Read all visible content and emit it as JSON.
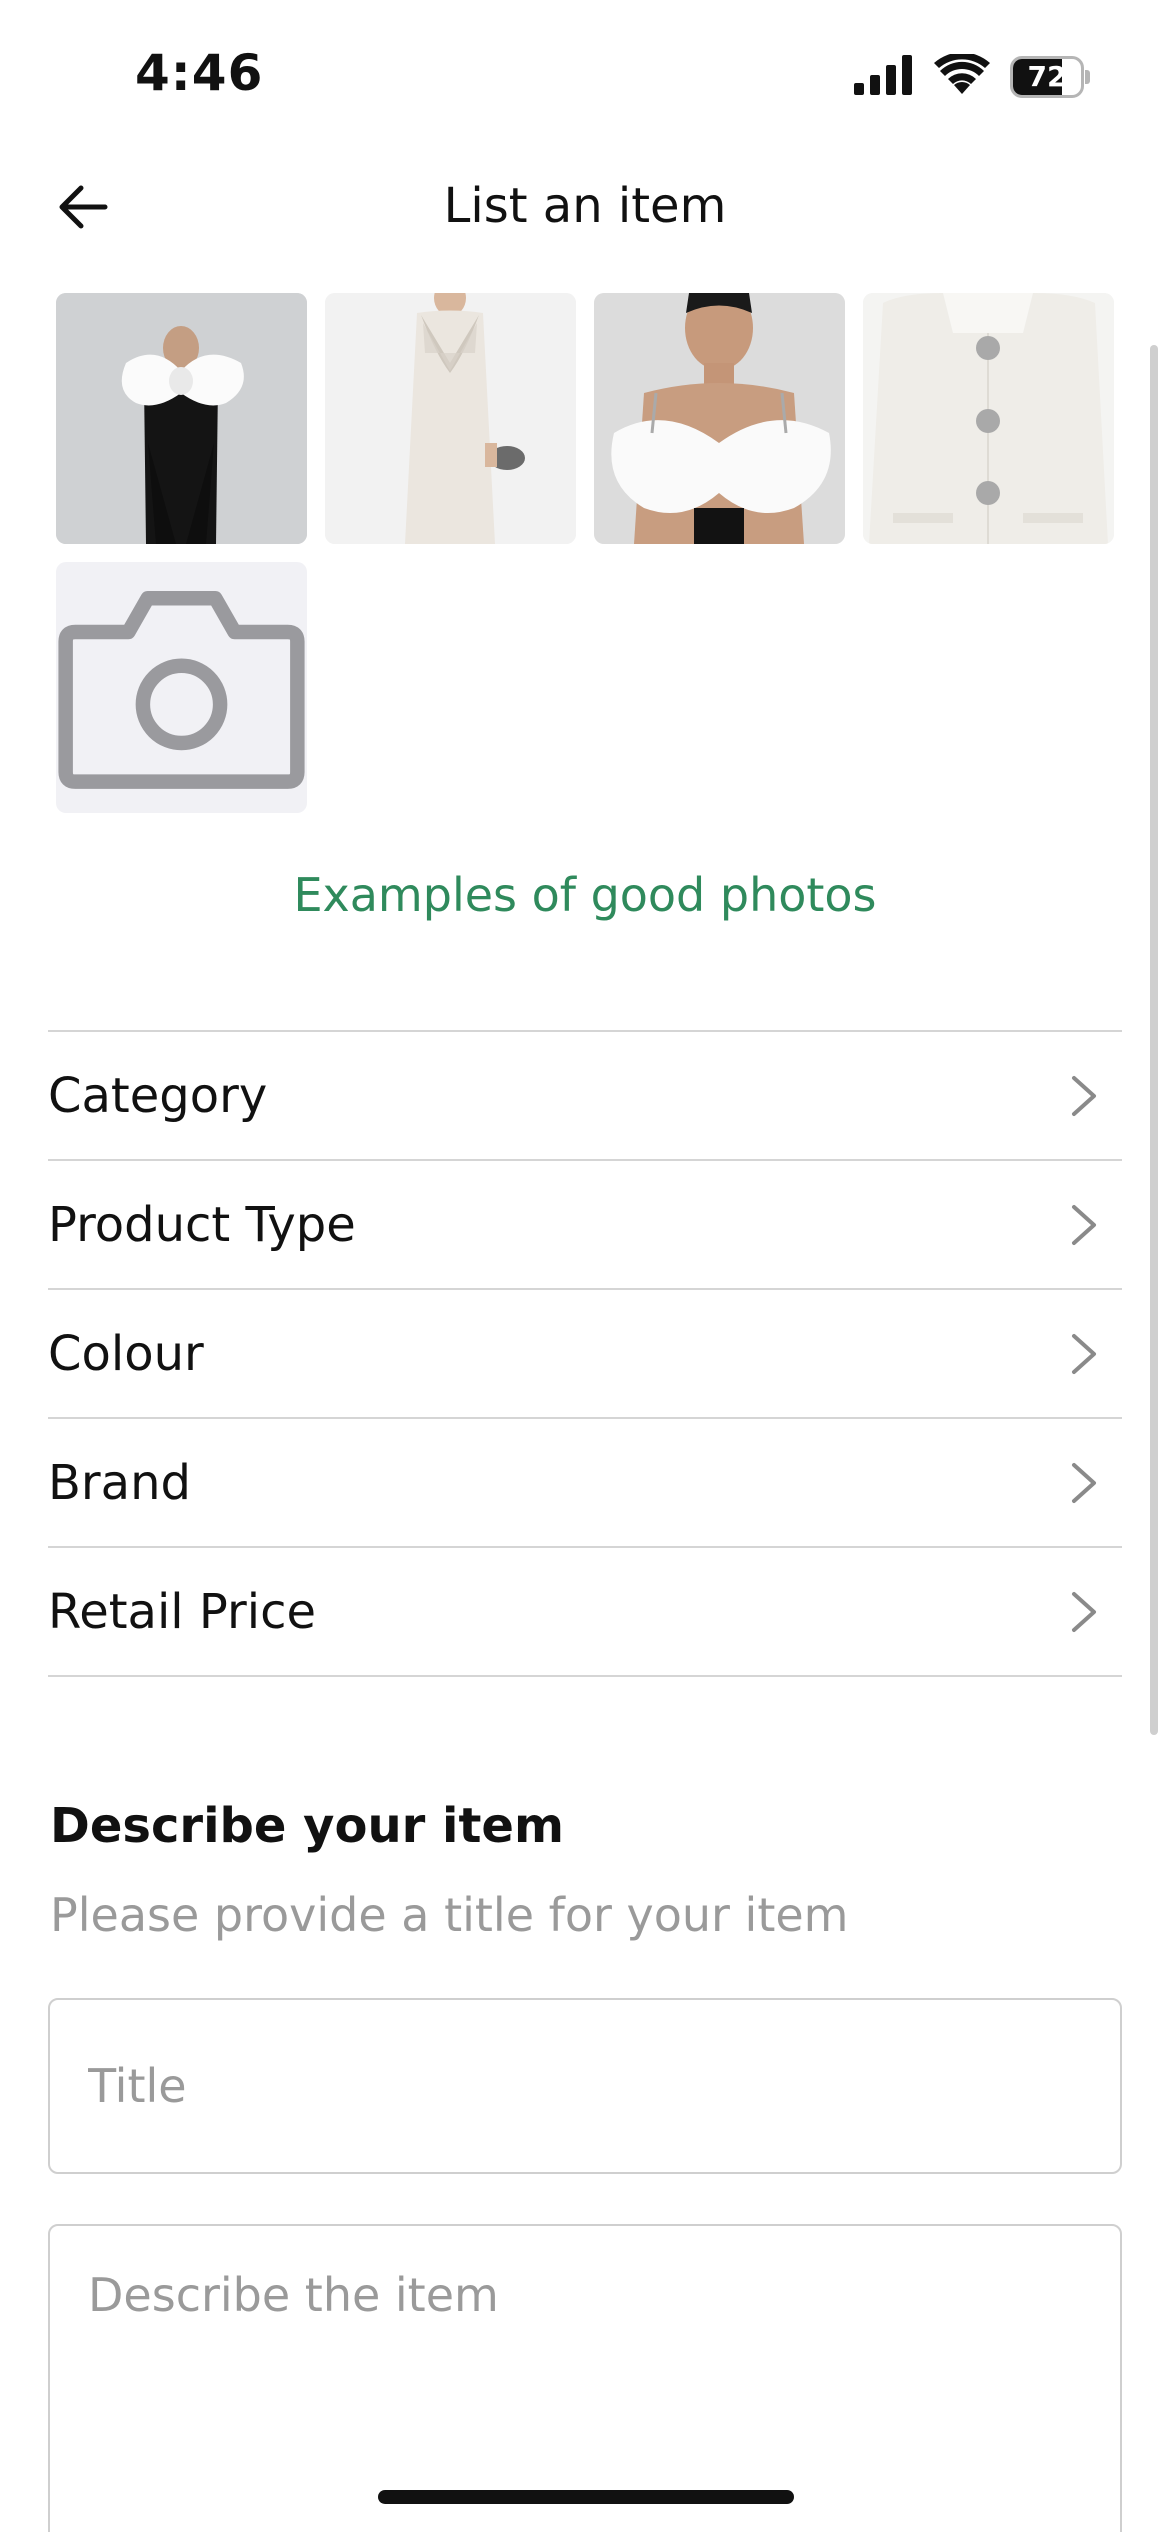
{
  "status_bar": {
    "time": "4:46",
    "battery_level": 72,
    "battery_text": "72",
    "icons": [
      "cellular-signal-icon",
      "wifi-icon",
      "battery-icon"
    ]
  },
  "header": {
    "title": "List an item",
    "back_icon": "arrow-left-icon"
  },
  "photos": {
    "items": [
      {
        "name": "photo-black-jumpsuit-white-bow"
      },
      {
        "name": "photo-white-dress-embellished"
      },
      {
        "name": "photo-white-bow-top"
      },
      {
        "name": "photo-white-blazer-jewel-buttons"
      }
    ],
    "add_icon": "camera-icon"
  },
  "examples_link": "Examples of good photos",
  "attributes": [
    {
      "label": "Category"
    },
    {
      "label": "Product Type"
    },
    {
      "label": "Colour"
    },
    {
      "label": "Brand"
    },
    {
      "label": "Retail Price"
    }
  ],
  "description": {
    "heading": "Describe your item",
    "subheading": "Please provide a title for your item",
    "title_placeholder": "Title",
    "title_value": "",
    "desc_placeholder": "Describe the item",
    "desc_value": ""
  },
  "colors": {
    "accent_green": "#2f8a5c",
    "divider": "#d5d5d5",
    "placeholder_grey": "#9a9a9a"
  }
}
